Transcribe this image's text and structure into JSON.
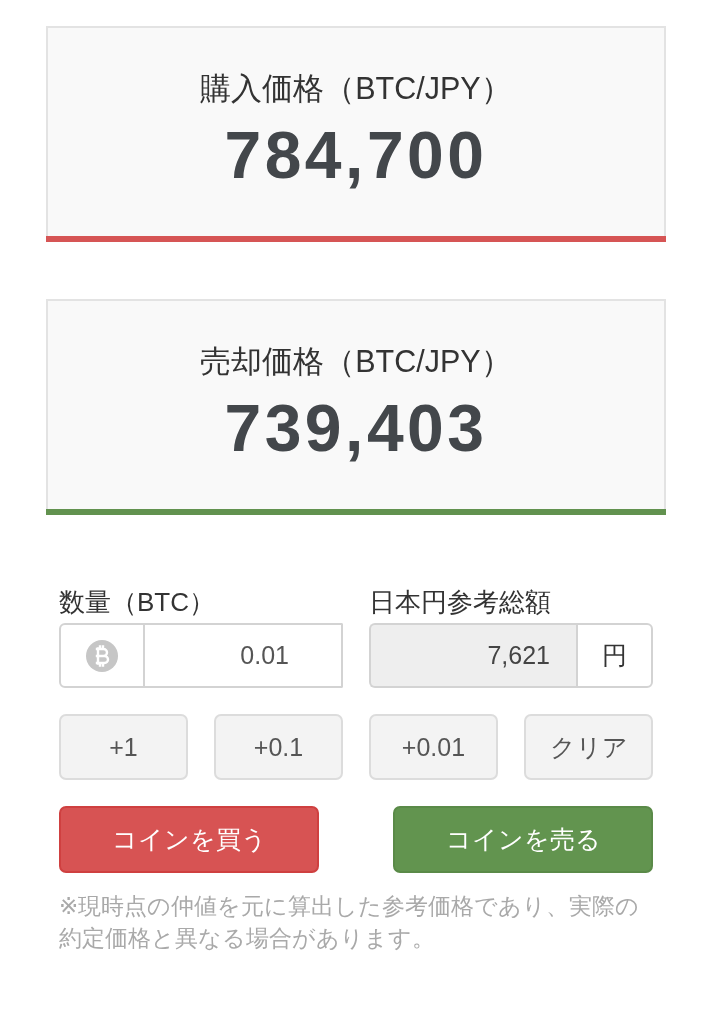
{
  "prices": [
    {
      "kind": "buy",
      "label": "購入価格（BTC/JPY）",
      "value": "784,700"
    },
    {
      "kind": "sell",
      "label": "売却価格（BTC/JPY）",
      "value": "739,403"
    }
  ],
  "quantity": {
    "label": "数量（BTC）",
    "value": "0.01"
  },
  "total": {
    "label": "日本円参考総額",
    "value": "7,621",
    "unit": "円"
  },
  "increment_buttons": [
    "+1",
    "+0.1",
    "+0.01",
    "クリア"
  ],
  "actions": [
    {
      "kind": "buy",
      "label": "コインを買う"
    },
    {
      "kind": "sell",
      "label": "コインを売る"
    }
  ],
  "note": "※現時点の仲値を元に算出した参考価格であり、実際の約定価格と異なる場合があります。"
}
